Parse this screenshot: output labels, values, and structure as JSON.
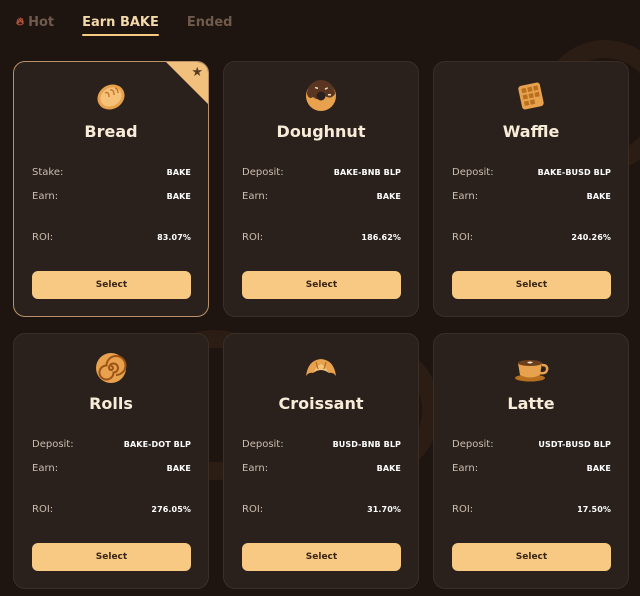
{
  "tabs": [
    {
      "label": "Hot",
      "active": false
    },
    {
      "label": "Earn BAKE",
      "active": true
    },
    {
      "label": "Ended",
      "active": false
    }
  ],
  "cards": [
    {
      "title": "Bread",
      "icon": "bread-icon",
      "rows": [
        {
          "label": "Stake:",
          "value": "BAKE"
        },
        {
          "label": "Earn:",
          "value": "BAKE"
        },
        {
          "label": "ROI:",
          "value": "83.07%"
        }
      ],
      "button": "Select",
      "highlighted": true
    },
    {
      "title": "Doughnut",
      "icon": "doughnut-icon",
      "rows": [
        {
          "label": "Deposit:",
          "value": "BAKE-BNB BLP"
        },
        {
          "label": "Earn:",
          "value": "BAKE"
        },
        {
          "label": "ROI:",
          "value": "186.62%"
        }
      ],
      "button": "Select",
      "highlighted": false
    },
    {
      "title": "Waffle",
      "icon": "waffle-icon",
      "rows": [
        {
          "label": "Deposit:",
          "value": "BAKE-BUSD BLP"
        },
        {
          "label": "Earn:",
          "value": "BAKE"
        },
        {
          "label": "ROI:",
          "value": "240.26%"
        }
      ],
      "button": "Select",
      "highlighted": false
    },
    {
      "title": "Rolls",
      "icon": "roll-icon",
      "rows": [
        {
          "label": "Deposit:",
          "value": "BAKE-DOT BLP"
        },
        {
          "label": "Earn:",
          "value": "BAKE"
        },
        {
          "label": "ROI:",
          "value": "276.05%"
        }
      ],
      "button": "Select",
      "highlighted": false
    },
    {
      "title": "Croissant",
      "icon": "croissant-icon",
      "rows": [
        {
          "label": "Deposit:",
          "value": "BUSD-BNB BLP"
        },
        {
          "label": "Earn:",
          "value": "BAKE"
        },
        {
          "label": "ROI:",
          "value": "31.70%"
        }
      ],
      "button": "Select",
      "highlighted": false
    },
    {
      "title": "Latte",
      "icon": "coffee-cup-icon",
      "rows": [
        {
          "label": "Deposit:",
          "value": "USDT-BUSD BLP"
        },
        {
          "label": "Earn:",
          "value": "BAKE"
        },
        {
          "label": "ROI:",
          "value": "17.50%"
        }
      ],
      "button": "Select",
      "highlighted": false
    }
  ],
  "colors": {
    "accent": "#f8c982",
    "card": "#2a211d",
    "background": "#1e1410"
  }
}
